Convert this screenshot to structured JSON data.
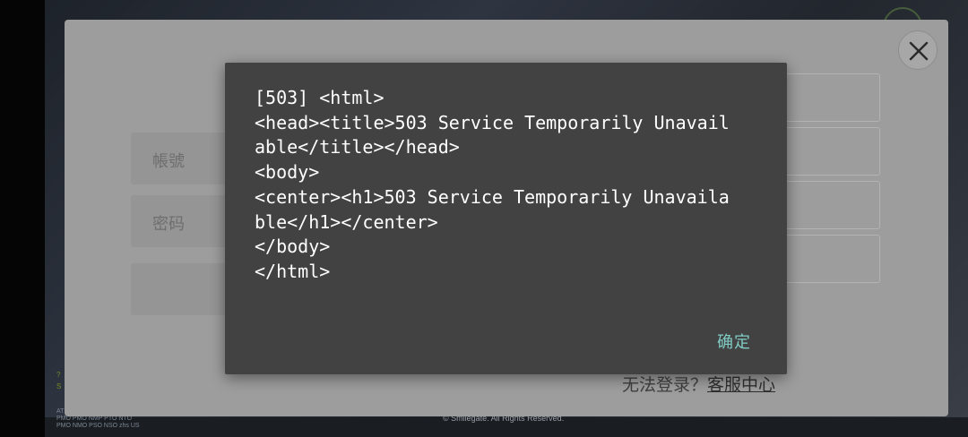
{
  "background": {
    "build_info_lines": [
      "AT",
      "PMO PMO NMP PTO NTO",
      "PMO NMO PSO NSO zhs US"
    ],
    "side_marks": [
      "?",
      "S"
    ],
    "copyright": "© Smilegate. All Rights Reserved."
  },
  "login": {
    "account_label": "帳號",
    "password_label": "密码",
    "help_text": "无法登录？",
    "help_link": "客服中心"
  },
  "dialog": {
    "message": "[503] <html>\n<head><title>503 Service Temporarily Unavailable</title></head>\n<body>\n<center><h1>503 Service Temporarily Unavailable</h1></center>\n</body>\n</html>",
    "ok_label": "确定"
  },
  "colors": {
    "dialog_bg": "#424242",
    "dialog_text": "#ffffff",
    "accent": "#80cbc4",
    "panel_dimmed": "#9d9d9d"
  },
  "icons": {
    "close": "close-icon"
  }
}
